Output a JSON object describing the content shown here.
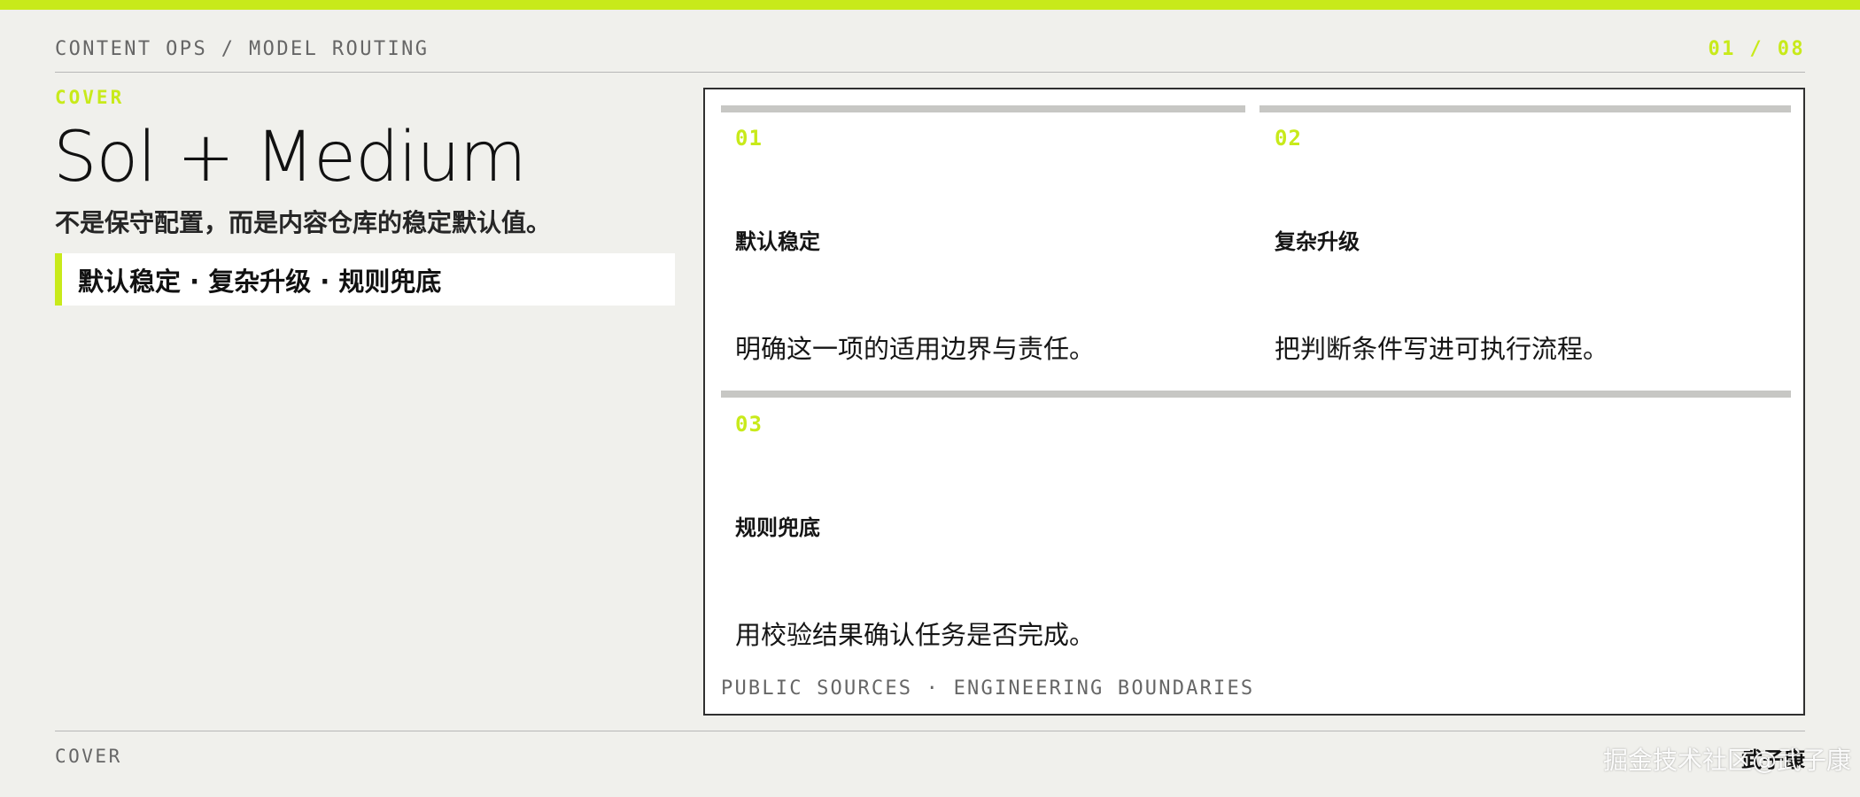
{
  "header": {
    "breadcrumb": "CONTENT OPS / MODEL ROUTING",
    "page_indicator": "01 / 08"
  },
  "hero": {
    "section_label": "COVER",
    "title": "Sol + Medium",
    "subtitle": "不是保守配置，而是内容仓库的稳定默认值。",
    "tagline": "默认稳定 · 复杂升级 · 规则兜底"
  },
  "panel": {
    "cards": [
      {
        "number": "01",
        "title": "默认稳定",
        "description": "明确这一项的适用边界与责任。"
      },
      {
        "number": "02",
        "title": "复杂升级",
        "description": "把判断条件写进可执行流程。"
      },
      {
        "number": "03",
        "title": "规则兜底",
        "description": "用校验结果确认任务是否完成。"
      }
    ],
    "footer": "PUBLIC SOURCES · ENGINEERING BOUNDARIES"
  },
  "footer": {
    "left_label": "COVER",
    "author": "武子康",
    "watermark": "掘金技术社区@武子康"
  },
  "colors": {
    "accent": "#c8ea1a",
    "background": "#f0f0ec",
    "panel_background": "#ffffff",
    "text_dark": "#151515",
    "text_muted": "#666666"
  }
}
